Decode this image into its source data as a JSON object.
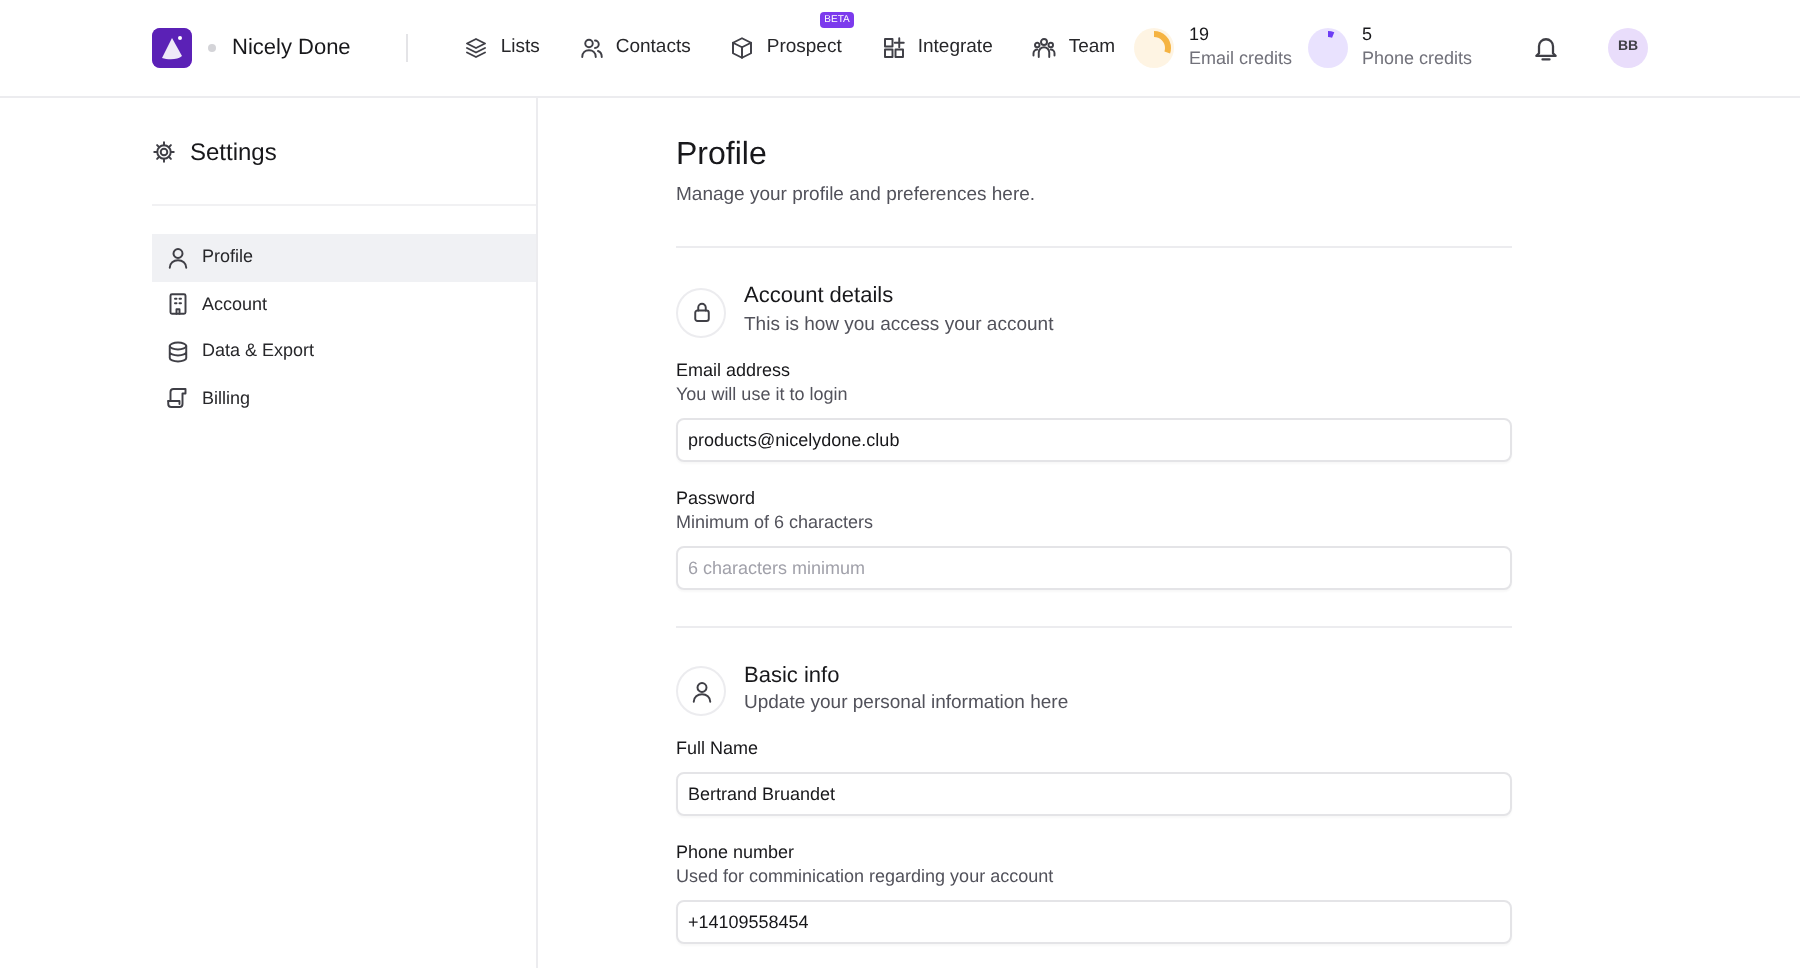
{
  "brand": {
    "name": "Nicely Done"
  },
  "nav": [
    {
      "label": "Lists"
    },
    {
      "label": "Contacts"
    },
    {
      "label": "Prospect",
      "badge": "BETA"
    },
    {
      "label": "Integrate"
    },
    {
      "label": "Team"
    }
  ],
  "credits": [
    {
      "count": "19",
      "label": "Email credits",
      "level": 0.3,
      "color": "#f5b342"
    },
    {
      "count": "5",
      "label": "Phone credits",
      "level": 0.06,
      "color": "#6d3df5"
    }
  ],
  "user": {
    "initials": "BB"
  },
  "sidebar": {
    "title": "Settings",
    "items": [
      {
        "label": "Profile",
        "selected": true
      },
      {
        "label": "Account",
        "selected": false
      },
      {
        "label": "Data & Export",
        "selected": false
      },
      {
        "label": "Billing",
        "selected": false
      }
    ]
  },
  "page": {
    "title": "Profile",
    "subtitle": "Manage your profile and preferences here."
  },
  "sections": [
    {
      "title": "Account details",
      "subtitle": "This is how you access your account",
      "fields": [
        {
          "label": "Email address",
          "hint": "You will use it to login",
          "value": "products@nicelydone.club"
        },
        {
          "label": "Password",
          "hint": "Minimum of 6 characters",
          "placeholder": "6 characters minimum"
        }
      ]
    },
    {
      "title": "Basic info",
      "subtitle": "Update your personal information here",
      "fields": [
        {
          "label": "Full Name",
          "value": "Bertrand Bruandet"
        },
        {
          "label": "Phone number",
          "hint": "Used for comminication regarding your account",
          "value": "+14109558454"
        }
      ]
    }
  ]
}
